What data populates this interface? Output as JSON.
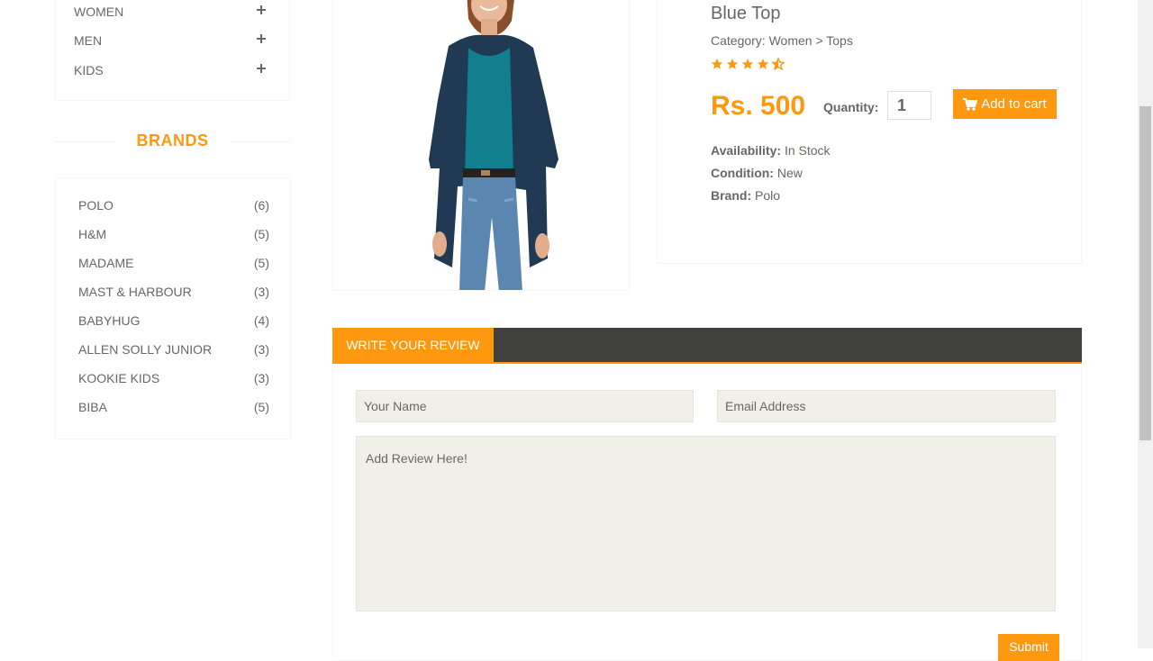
{
  "sidebar": {
    "categories": [
      {
        "label": "WOMEN"
      },
      {
        "label": "MEN"
      },
      {
        "label": "KIDS"
      }
    ],
    "brands_title": "BRANDS",
    "brands": [
      {
        "name": "POLO",
        "count": "(6)"
      },
      {
        "name": "H&M",
        "count": "(5)"
      },
      {
        "name": "MADAME",
        "count": "(5)"
      },
      {
        "name": "MAST & HARBOUR",
        "count": "(3)"
      },
      {
        "name": "BABYHUG",
        "count": "(4)"
      },
      {
        "name": "ALLEN SOLLY JUNIOR",
        "count": "(3)"
      },
      {
        "name": "KOOKIE KIDS",
        "count": "(3)"
      },
      {
        "name": "BIBA",
        "count": "(5)"
      }
    ]
  },
  "product": {
    "title": "Blue Top",
    "category": "Category: Women > Tops",
    "rating": 4.5,
    "price": "Rs. 500",
    "quantity_label": "Quantity:",
    "quantity_value": "1",
    "add_to_cart_label": "Add to cart",
    "availability_label": "Availability:",
    "availability_value": " In Stock",
    "condition_label": "Condition:",
    "condition_value": " New",
    "brand_label": "Brand:",
    "brand_value": " Polo"
  },
  "review": {
    "tab_label": "WRITE YOUR REVIEW",
    "name_placeholder": "Your Name",
    "email_placeholder": "Email Address",
    "review_placeholder": "Add Review Here!",
    "submit_label": "Submit"
  },
  "colors": {
    "accent": "#fe980f",
    "text": "#696763",
    "tab_bar": "#40403e",
    "field_bg": "#f0f0e9"
  },
  "icons": {
    "category_expand": "plus-icon",
    "rating": "star-icon",
    "cart": "shopping-cart-icon"
  }
}
